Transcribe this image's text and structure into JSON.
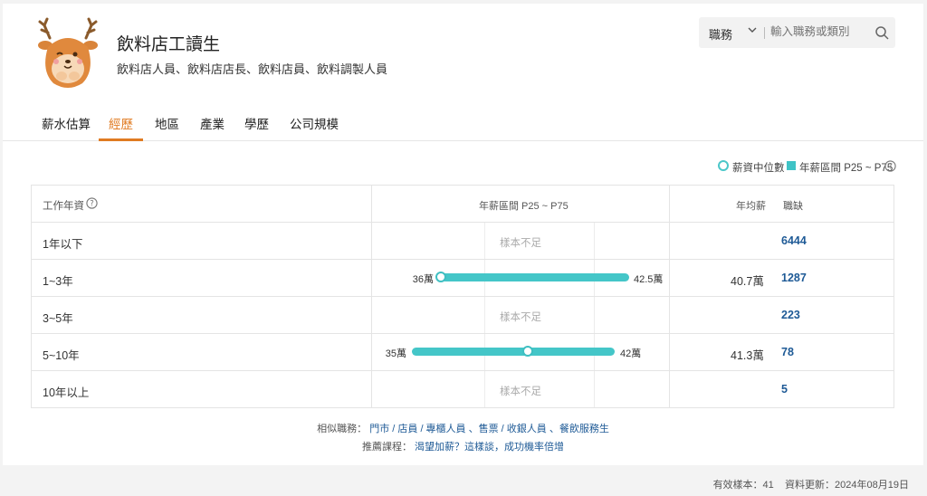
{
  "header": {
    "title": "飲料店工讀生",
    "subtitle": "飲料店人員、飲料店店長、飲料店員、飲料調製人員",
    "avatar_icon": "deer-mascot-icon"
  },
  "search": {
    "selected": "職務",
    "placeholder": "輸入職務或類別"
  },
  "tabs": [
    {
      "label": "薪水估算"
    },
    {
      "label": "經歷",
      "active": true
    },
    {
      "label": "地區"
    },
    {
      "label": "產業"
    },
    {
      "label": "學歷"
    },
    {
      "label": "公司規模"
    }
  ],
  "legend": {
    "median": "薪資中位數",
    "range": "年薪區間 P25 ~ P75"
  },
  "table": {
    "headers": {
      "experience": "工作年資",
      "range": "年薪區間 P25 ~ P75",
      "avg": "年均薪",
      "vacancy": "職缺"
    },
    "rows": [
      {
        "experience": "1年以下",
        "insufficient": "樣本不足",
        "vacancy": "6444"
      },
      {
        "experience": "1~3年",
        "p25": "36萬",
        "p75": "42.5萬",
        "p25_value": 36,
        "p75_value": 42.5,
        "median_value": 36,
        "avg": "40.7萬",
        "vacancy": "1287"
      },
      {
        "experience": "3~5年",
        "insufficient": "樣本不足",
        "vacancy": "223"
      },
      {
        "experience": "5~10年",
        "p25": "35萬",
        "p75": "42萬",
        "p25_value": 35,
        "p75_value": 42,
        "median_value": 39,
        "avg": "41.3萬",
        "vacancy": "78"
      },
      {
        "experience": "10年以上",
        "insufficient": "樣本不足",
        "vacancy": "5"
      }
    ]
  },
  "similar": {
    "label": "相似職務：",
    "links": "門市 / 店員 / 專櫃人員 、售票 / 收銀人員 、餐飲服務生"
  },
  "course": {
    "label": "推薦課程：",
    "link": "渴望加薪？這樣談，成功機率倍增"
  },
  "footer": {
    "samples": "有效樣本：41",
    "updated": "資料更新：2024年08月19日"
  },
  "colors": {
    "accent": "#e07b22",
    "bar": "#44c6c8",
    "link": "#1e5a96"
  }
}
